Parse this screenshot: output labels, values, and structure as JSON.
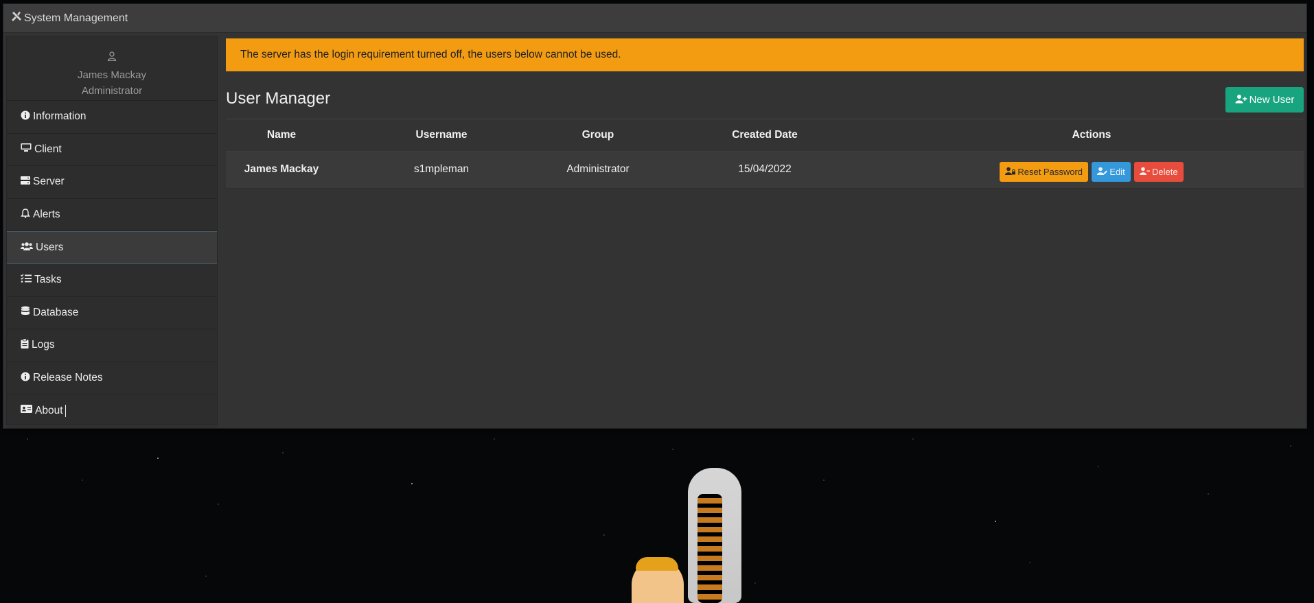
{
  "window": {
    "title": "System Management"
  },
  "profile": {
    "name": "James Mackay",
    "role": "Administrator"
  },
  "sidebar": {
    "items": [
      {
        "label": "Information",
        "icon": "info-circle-icon"
      },
      {
        "label": "Client",
        "icon": "monitor-icon"
      },
      {
        "label": "Server",
        "icon": "server-icon"
      },
      {
        "label": "Alerts",
        "icon": "bell-icon"
      },
      {
        "label": "Users",
        "icon": "users-icon",
        "active": true
      },
      {
        "label": "Tasks",
        "icon": "task-list-icon"
      },
      {
        "label": "Database",
        "icon": "database-icon"
      },
      {
        "label": "Logs",
        "icon": "clipboard-icon"
      },
      {
        "label": "Release Notes",
        "icon": "info-circle-icon"
      },
      {
        "label": "About",
        "icon": "id-card-icon"
      }
    ]
  },
  "alert": {
    "text": "The server has the login requirement turned off, the users below cannot be used.",
    "color": "#f39c12"
  },
  "main": {
    "title": "User Manager",
    "new_user_label": "New User"
  },
  "table": {
    "headers": [
      "Name",
      "Username",
      "Group",
      "Created Date",
      "Actions"
    ],
    "rows": [
      {
        "name": "James Mackay",
        "username": "s1mpleman",
        "group": "Administrator",
        "created": "15/04/2022",
        "actions": {
          "reset": "Reset Password",
          "edit": "Edit",
          "delete": "Delete"
        }
      }
    ]
  },
  "colors": {
    "success": "#18a47e",
    "warning": "#f39c12",
    "info": "#3498db",
    "danger": "#e74c3c"
  }
}
